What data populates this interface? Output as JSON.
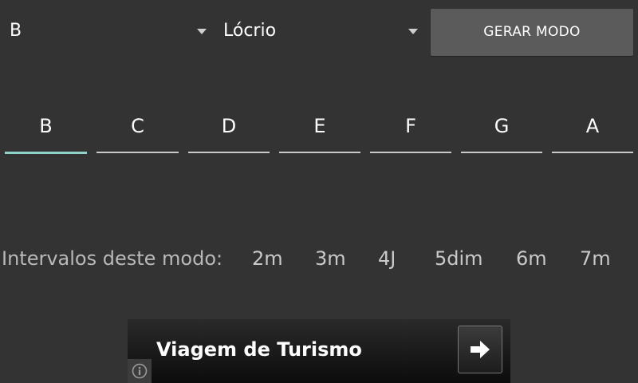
{
  "top_bar": {
    "note_select": {
      "value": "B",
      "icon": "dropdown-arrow-icon"
    },
    "mode_select": {
      "value": "Lócrio",
      "icon": "dropdown-arrow-icon"
    },
    "generate_button": {
      "label": "GERAR MODO"
    }
  },
  "notes": {
    "selected_index": 0,
    "items": [
      {
        "label": "B"
      },
      {
        "label": "C"
      },
      {
        "label": "D"
      },
      {
        "label": "E"
      },
      {
        "label": "F"
      },
      {
        "label": "G"
      },
      {
        "label": "A"
      }
    ]
  },
  "intervals": {
    "label": "Intervalos deste modo:",
    "items": [
      "2m",
      "3m",
      "4J",
      "5dim",
      "6m",
      "7m"
    ]
  },
  "ad": {
    "title": "Viagem de Turismo",
    "action_icon": "arrow-right-icon",
    "info_icon": "info-icon"
  },
  "colors": {
    "background": "#333333",
    "button": "#5b5b5b",
    "accent_underline": "#8fd3c9",
    "underline": "#c9c9c9",
    "secondary_text": "#b9b9b9"
  }
}
